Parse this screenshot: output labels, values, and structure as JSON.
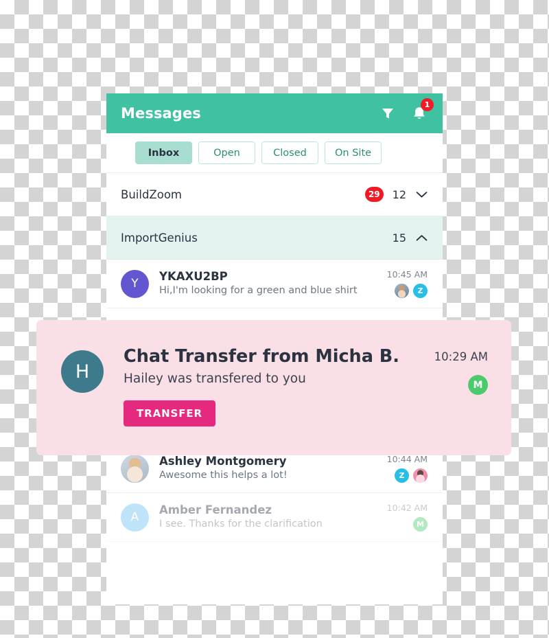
{
  "header": {
    "title": "Messages",
    "filter_icon": "filter-funnel-icon",
    "bell_icon": "bell-icon",
    "bell_badge": "1"
  },
  "tabs": [
    {
      "label": "Inbox",
      "active": true
    },
    {
      "label": "Open",
      "active": false
    },
    {
      "label": "Closed",
      "active": false
    },
    {
      "label": "On Site",
      "active": false
    }
  ],
  "groups": [
    {
      "name": "BuildZoom",
      "unread_badge": "29",
      "count": "12",
      "chevron": "chevron-down-icon",
      "expanded": false
    },
    {
      "name": "ImportGenius",
      "unread_badge": "",
      "count": "15",
      "chevron": "chevron-up-icon",
      "expanded": true
    }
  ],
  "messages": [
    {
      "avatar_letter": "Y",
      "avatar_color": "#6257d0",
      "name": "YKAXU2BP",
      "preview": "Hi,I'm looking for a green and blue shirt",
      "time": "10:45 AM",
      "meta": [
        {
          "kind": "photo",
          "style": "photo-a",
          "letter": ""
        },
        {
          "kind": "letter",
          "color": "#27bfe6",
          "letter": "Z"
        }
      ],
      "faded": false
    },
    {
      "avatar_letter": "",
      "avatar_color": "",
      "avatar_photo": "photo-b",
      "name": "Ashley Montgomery",
      "preview": "Awesome this helps a lot!",
      "time": "10:44 AM",
      "meta": [
        {
          "kind": "letter",
          "color": "#27bfe6",
          "letter": "Z"
        },
        {
          "kind": "photo",
          "style": "photo-c",
          "letter": ""
        }
      ],
      "faded": false
    },
    {
      "avatar_letter": "A",
      "avatar_color": "#69bdf2",
      "name": "Amber Fernandez",
      "preview": "I see. Thanks for the clarification",
      "time": "10:42 AM",
      "meta": [
        {
          "kind": "letter",
          "color": "#4ccb6c",
          "letter": "M"
        }
      ],
      "faded": true
    }
  ],
  "chat_transfer": {
    "avatar_letter": "H",
    "title": "Chat Transfer from Micha B.",
    "subtitle": "Hailey was transfered to you",
    "button_label": "TRANSFER",
    "time": "10:29 AM",
    "agent_letter": "M"
  },
  "colors": {
    "brand_green": "#3fc1a2",
    "tab_active": "#a8ded0",
    "group_highlight": "#e4f3ef",
    "badge_red": "#ee1a24",
    "card_pink": "#fadfe7",
    "transfer_pink": "#e5297f",
    "avatar_teal": "#3d7a8c",
    "avatar_green": "#4ccb6c"
  }
}
